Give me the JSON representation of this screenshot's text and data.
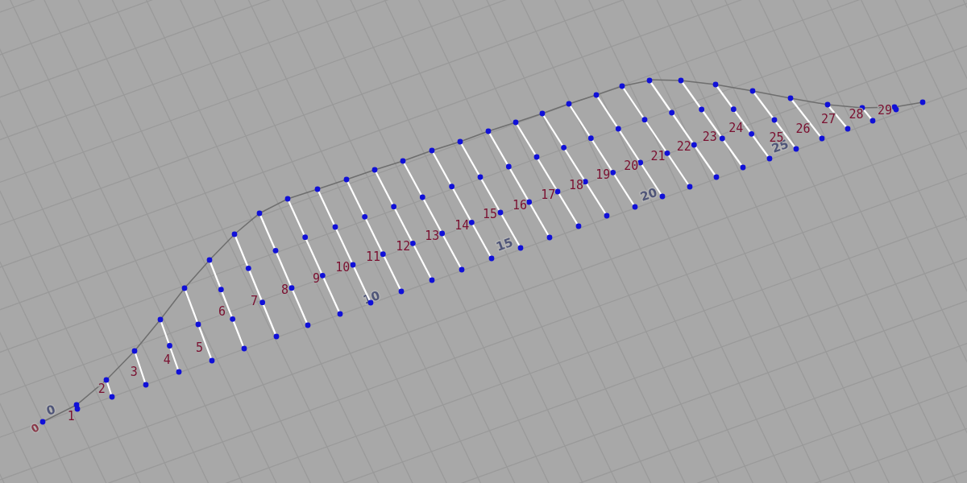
{
  "viewport": {
    "stations": [
      {
        "label": "1"
      },
      {
        "label": "2"
      },
      {
        "label": "3"
      },
      {
        "label": "4"
      },
      {
        "label": "5"
      },
      {
        "label": "6"
      },
      {
        "label": "7"
      },
      {
        "label": "8"
      },
      {
        "label": "9"
      },
      {
        "label": "10"
      },
      {
        "label": "11"
      },
      {
        "label": "12"
      },
      {
        "label": "13"
      },
      {
        "label": "14"
      },
      {
        "label": "15"
      },
      {
        "label": "16"
      },
      {
        "label": "17"
      },
      {
        "label": "18"
      },
      {
        "label": "19"
      },
      {
        "label": "20"
      },
      {
        "label": "21"
      },
      {
        "label": "22"
      },
      {
        "label": "23"
      },
      {
        "label": "24"
      },
      {
        "label": "25"
      },
      {
        "label": "26"
      },
      {
        "label": "27"
      },
      {
        "label": "28"
      },
      {
        "label": "29"
      }
    ],
    "grid_labels": [
      {
        "text": "0",
        "color": "#8a3848"
      },
      {
        "text": "0",
        "color": "#4f5578"
      },
      {
        "text": "10",
        "color": "#4f5578"
      },
      {
        "text": "15",
        "color": "#4f5578"
      },
      {
        "text": "20",
        "color": "#4f5578"
      },
      {
        "text": "25",
        "color": "#4f5578"
      }
    ]
  }
}
